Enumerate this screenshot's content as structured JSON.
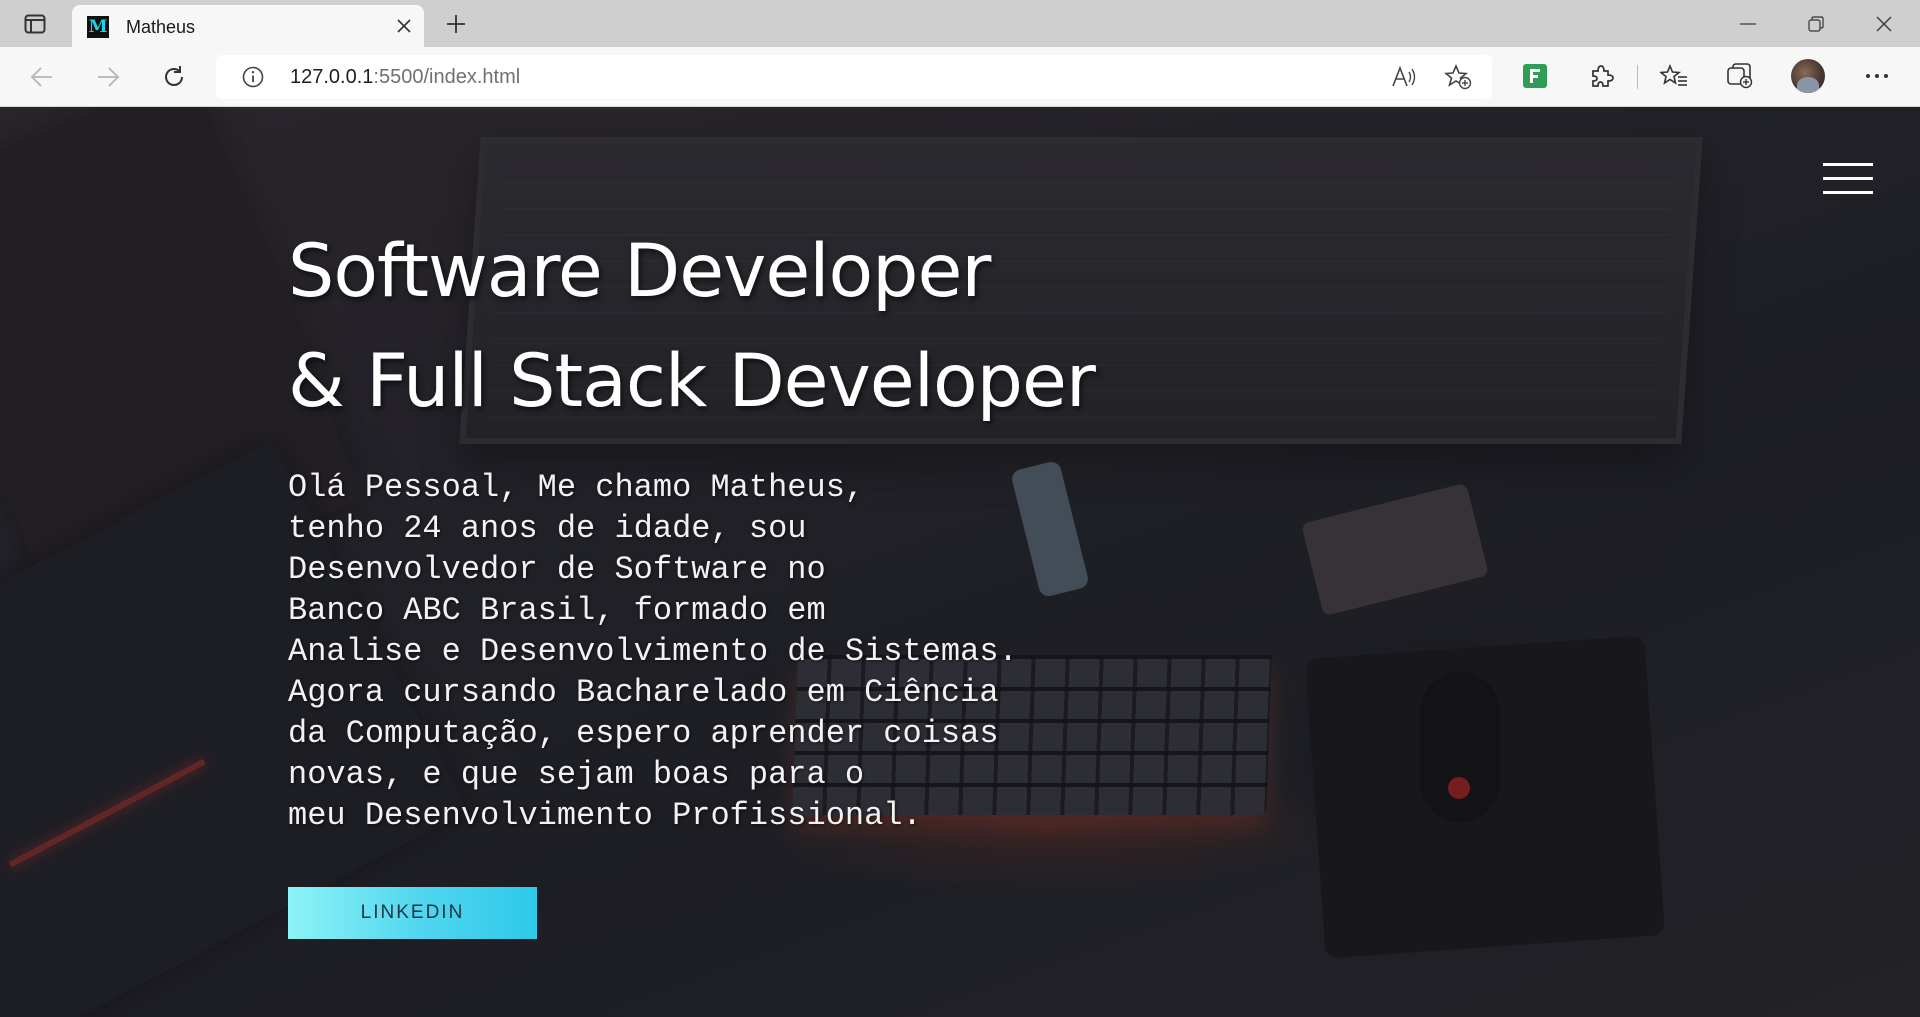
{
  "browser": {
    "tab": {
      "favicon_letter": "M",
      "title": "Matheus"
    },
    "address": {
      "host": "127.0.0.1",
      "rest": ":5500/index.html"
    },
    "icons": {
      "tab_actions": "tab-actions-icon",
      "close_tab": "close-icon",
      "new_tab": "plus-icon",
      "minimize": "minimize-icon",
      "restore": "restore-icon",
      "close_window": "close-icon",
      "back": "back-arrow-icon",
      "forward": "forward-arrow-icon",
      "refresh": "refresh-icon",
      "site_info": "info-icon",
      "read_aloud": "read-aloud-icon",
      "favorite_add": "star-add-icon",
      "extension_green": "extension-green-icon",
      "extensions": "puzzle-icon",
      "favorites": "favorites-icon",
      "collections": "collections-icon",
      "profile": "avatar",
      "more": "more-icon"
    },
    "colors": {
      "favicon_bg": "#111111",
      "favicon_fg": "#17d4e8",
      "extension_green": "#2e9d57"
    }
  },
  "hero": {
    "title_line1": "Software Developer",
    "title_line2": "& Full Stack Developer",
    "bio_lines": [
      "Olá Pessoal, Me chamo Matheus,",
      "tenho 24 anos de idade, sou",
      "Desenvolvedor de Software no",
      "Banco ABC Brasil, formado em",
      "Analise e Desenvolvimento de Sistemas.",
      "Agora cursando Bacharelado em Ciência",
      "da Computação, espero aprender coisas",
      "novas, e que sejam boas para o",
      "meu Desenvolvimento Profissional."
    ],
    "button_label": "LINKEDIN",
    "menu_icon": "hamburger-menu-icon",
    "colors": {
      "button_gradient_start": "#8df3f6",
      "button_gradient_end": "#2ec9ea",
      "text": "#ffffff"
    }
  }
}
